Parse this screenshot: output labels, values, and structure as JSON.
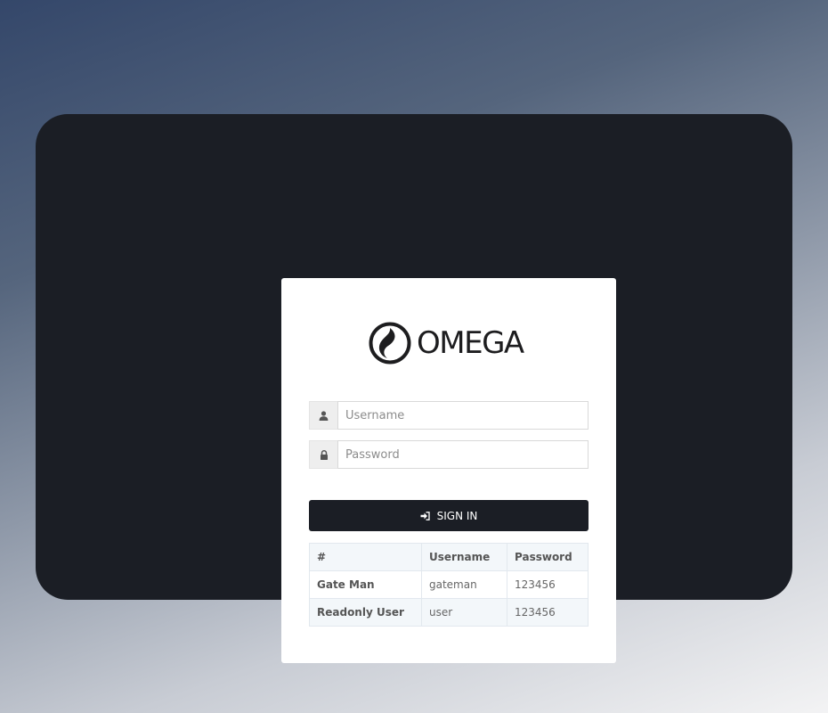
{
  "brand": {
    "name": "OMEGA"
  },
  "login": {
    "username_placeholder": "Username",
    "password_placeholder": "Password",
    "username_value": "",
    "password_value": "",
    "signin_label": "SIGN IN"
  },
  "credentials_table": {
    "headers": [
      "#",
      "Username",
      "Password"
    ],
    "rows": [
      {
        "name": "Gate Man",
        "username": "gateman",
        "password": "123456"
      },
      {
        "name": "Readonly User",
        "username": "user",
        "password": "123456"
      }
    ]
  },
  "icons": {
    "username": "user-icon",
    "password": "lock-icon",
    "signin": "sign-in-icon",
    "logo": "omega-logo"
  },
  "colors": {
    "panel": "#1b1e25",
    "button": "#1b1e25",
    "card": "#ffffff",
    "table_header": "#f3f7fa"
  }
}
